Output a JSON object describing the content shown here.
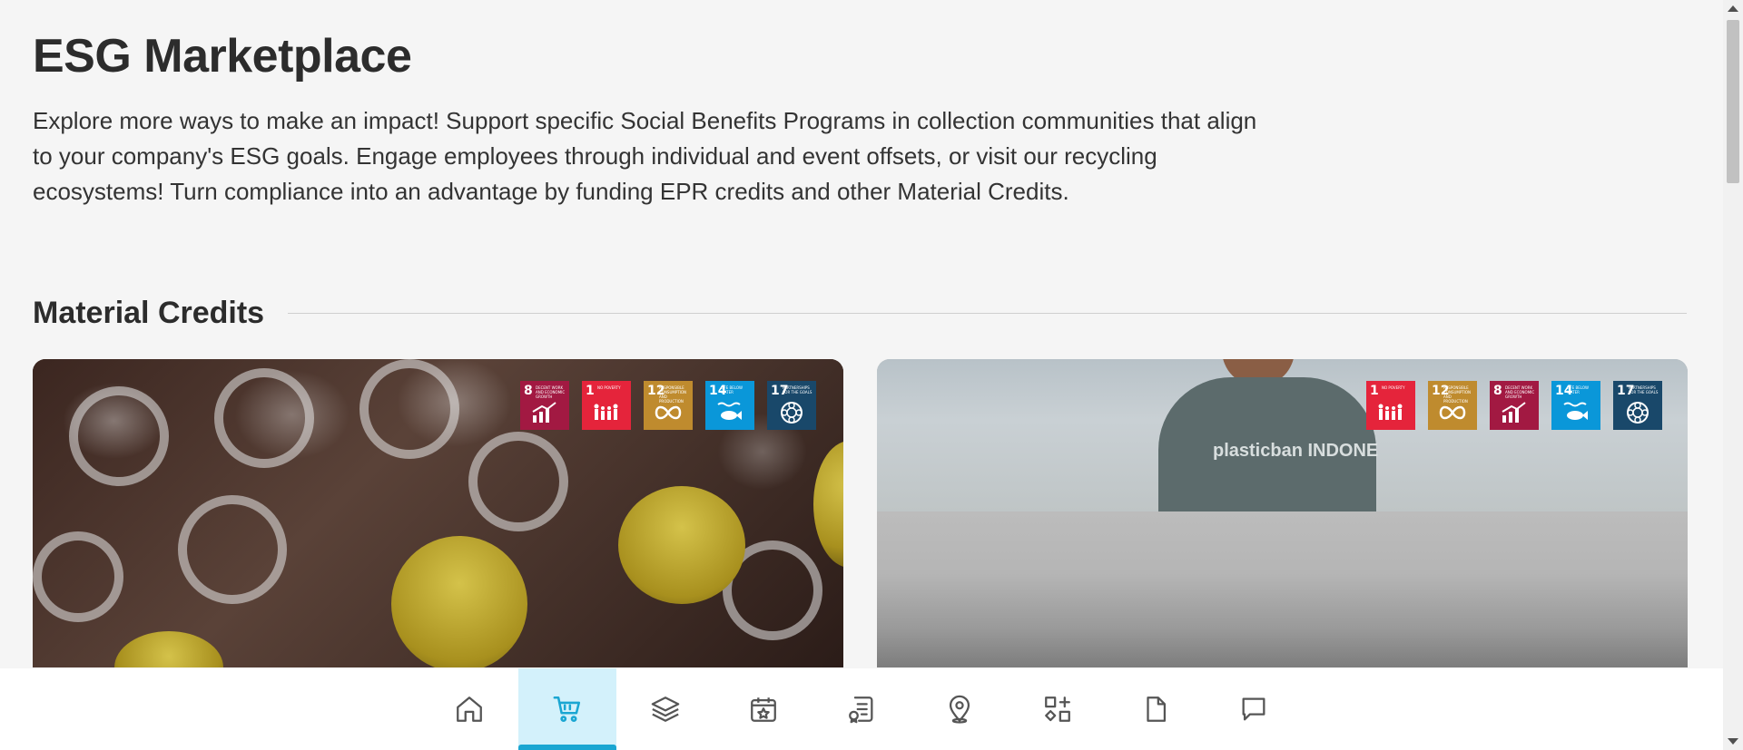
{
  "header": {
    "title": "ESG Marketplace",
    "intro": "Explore more ways to make an impact! Support specific Social Benefits Programs in collection communities that align to your company's ESG goals. Engage employees through individual and event offsets, or visit our recycling ecosystems! Turn compliance into an advantage by funding EPR credits and other Material Credits."
  },
  "section": {
    "title": "Material Credits"
  },
  "cards": [
    {
      "sdgs": [
        {
          "num": "8",
          "label": "Decent work and economic growth",
          "color": "#a21942"
        },
        {
          "num": "1",
          "label": "No poverty",
          "color": "#e5243b"
        },
        {
          "num": "12",
          "label": "Responsible consumption and production",
          "color": "#bf8b2e"
        },
        {
          "num": "14",
          "label": "Life below water",
          "color": "#0a97d9"
        },
        {
          "num": "17",
          "label": "Partnerships for the goals",
          "color": "#19486a"
        }
      ]
    },
    {
      "shirt_text": "plasticban INDONE",
      "sdgs": [
        {
          "num": "1",
          "label": "No poverty",
          "color": "#e5243b"
        },
        {
          "num": "12",
          "label": "Responsible consumption and production",
          "color": "#bf8b2e"
        },
        {
          "num": "8",
          "label": "Decent work and economic growth",
          "color": "#a21942"
        },
        {
          "num": "14",
          "label": "Life below water",
          "color": "#0a97d9"
        },
        {
          "num": "17",
          "label": "Partnerships for the goals",
          "color": "#19486a"
        }
      ]
    }
  ],
  "bottom_nav": {
    "active": "marketplace",
    "accent": "#1aa6d2",
    "items": [
      "home-icon",
      "cart-icon",
      "layers-icon",
      "calendar-star-icon",
      "certificate-icon",
      "map-pin-icon",
      "apps-icon",
      "document-icon",
      "chat-icon"
    ]
  }
}
